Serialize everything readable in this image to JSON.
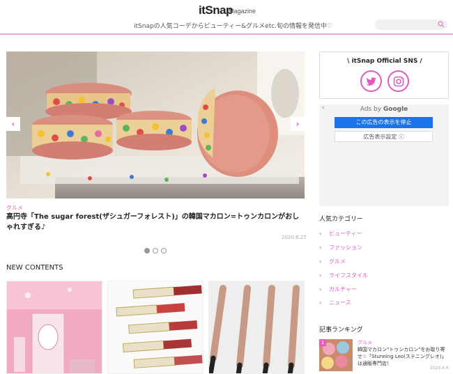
{
  "header": {
    "logo": "itSnap",
    "logo_sub": "Magazine",
    "tagline": "itSnapの人気コーデからビューティー&グルメetc.旬の情報を発信中♡",
    "search_placeholder": "",
    "search_icon": "search-icon"
  },
  "featured": {
    "image": "macaron-sandwiches-photo",
    "prev_icon": "chevron-left-icon",
    "next_icon": "chevron-right-icon",
    "category": "グルメ",
    "title": "高円寺「The sugar forest(ザシュガーフォレスト)」の韓国マカロン=トゥンカロンがおしゃれすぎる♪",
    "date": "2020.6.27",
    "pagination": {
      "count": 3,
      "active": 1
    }
  },
  "new_contents": {
    "title": "NEW CONTENTS",
    "thumbs": [
      "pink-cosmetics-box-photo",
      "lipstick-tubes-photo",
      "curling-irons-photo"
    ]
  },
  "sns": {
    "title": "\\ itSnap Official SNS /",
    "icons": [
      "twitter-icon",
      "instagram-icon"
    ]
  },
  "ads": {
    "back": "‹",
    "label_prefix": "Ads by ",
    "label_brand": "Google",
    "stop_button": "この広告の表示を停止",
    "settings_button": "広告表示設定 ⓘ"
  },
  "categories": {
    "title": "人気カテゴリー",
    "items": [
      "ビューティー",
      "ファッション",
      "グルメ",
      "ライフスタイル",
      "カルチャー",
      "ニュース"
    ]
  },
  "ranking": {
    "title": "記事ランキング",
    "items": [
      {
        "rank": "1",
        "category": "グルメ",
        "text": "韓国マカロン\"トゥンカロン\"をお取り寄せ☆「Stunning Leo(ステニングレオ)」は通販専門店！",
        "date": "2020.4.6"
      }
    ]
  },
  "colors": {
    "accent": "#e05cbf",
    "header_line": "#e8a7d6",
    "ad_blue": "#1a73e8"
  }
}
